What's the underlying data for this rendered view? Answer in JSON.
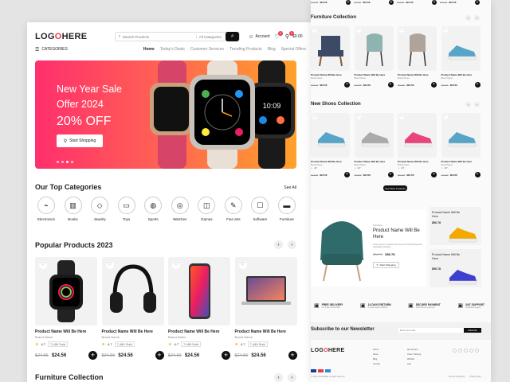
{
  "left": {
    "header": {
      "logo_a": "LOG",
      "logo_b": "O",
      "logo_c": "HERE",
      "search_placeholder": "Search Products",
      "category_select": "All Categories",
      "account": "Account",
      "wishlist_count": "0",
      "cart_count": "0",
      "cart_total": "$0.00"
    },
    "nav": {
      "categories": "CATEGORIES",
      "links": [
        "Home",
        "Today's Deals",
        "Customer Services",
        "Trending Products",
        "Blog",
        "Special Offers"
      ]
    },
    "hero": {
      "line1": "New Year Sale",
      "line2": "Offer 2024",
      "line3": "20% OFF",
      "cta": "Start Shopping",
      "watch_time": "10:09"
    },
    "categories": {
      "title": "Our Top Categories",
      "see_all": "See All",
      "items": [
        {
          "label": "Electronics",
          "icon": "plug-icon",
          "glyph": "⌁"
        },
        {
          "label": "Books",
          "icon": "books-icon",
          "glyph": "▥"
        },
        {
          "label": "Jewelry",
          "icon": "diamond-icon",
          "glyph": "◇"
        },
        {
          "label": "Toys",
          "icon": "car-icon",
          "glyph": "▭"
        },
        {
          "label": "Sports",
          "icon": "ball-icon",
          "glyph": "◍"
        },
        {
          "label": "Watches",
          "icon": "watch-icon",
          "glyph": "◎"
        },
        {
          "label": "Games",
          "icon": "gamepad-icon",
          "glyph": "◫"
        },
        {
          "label": "Fine arts",
          "icon": "brush-icon",
          "glyph": "✎"
        },
        {
          "label": "Software",
          "icon": "cup-icon",
          "glyph": "☐"
        },
        {
          "label": "Furniture",
          "icon": "sofa-icon",
          "glyph": "▬"
        }
      ]
    },
    "popular": {
      "title": "Popular Products 2023",
      "products": [
        {
          "name": "Product Name Will Be Here",
          "brand": "Brand Name",
          "rating": "4.7",
          "sold": "7,489 Sold",
          "old": "$24.56",
          "price": "$24.56",
          "icon": "smartwatch-icon"
        },
        {
          "name": "Product Name Will Be Here",
          "brand": "Brand Name",
          "rating": "4.7",
          "sold": "7,489 Sold",
          "old": "$24.56",
          "price": "$24.56",
          "icon": "headphones-icon"
        },
        {
          "name": "Product Name Will Be Here",
          "brand": "Brand Name",
          "rating": "4.7",
          "sold": "7,489 Sold",
          "old": "$24.56",
          "price": "$24.56",
          "icon": "smartphone-icon"
        },
        {
          "name": "Product Name Will Be Here",
          "brand": "Brand Name",
          "rating": "4.7",
          "sold": "7,489 Sold",
          "old": "$24.56",
          "price": "$24.56",
          "icon": "laptop-icon"
        }
      ]
    },
    "furniture_title": "Furniture Collection"
  },
  "right": {
    "top_prices": [
      {
        "old": "$24.56",
        "price": "$24.56"
      },
      {
        "old": "$24.56",
        "price": "$24.56"
      },
      {
        "old": "$24.56",
        "price": "$24.56"
      },
      {
        "old": "$24.56",
        "price": "$24.56"
      }
    ],
    "furniture": {
      "title": "Furniture Collection",
      "products": [
        {
          "name": "Product Name Will Be Here",
          "brand": "Brand Name",
          "old": "$24.56",
          "price": "$24.56",
          "icon": "armchair-icon",
          "color": "#3d4a66"
        },
        {
          "name": "Product Name Will Be Here",
          "brand": "Brand Name",
          "old": "$24.56",
          "price": "$24.56",
          "icon": "chair-icon",
          "color": "#8fb3b0"
        },
        {
          "name": "Product Name Will Be Here",
          "brand": "Brand Name",
          "old": "$24.56",
          "price": "$24.56",
          "icon": "chair-icon",
          "color": "#b0a39a"
        },
        {
          "name": "Product Name Will Be Here",
          "brand": "Brand Name",
          "old": "$24.56",
          "price": "$24.56",
          "icon": "sneaker-icon",
          "color": "#57a4c9"
        }
      ]
    },
    "shoes": {
      "title": "New Shoes Collection",
      "see_more": "See More Products",
      "products": [
        {
          "name": "Product Name Will Be Here",
          "brand": "Brand Name",
          "rating": "4.7",
          "old": "$24.56",
          "price": "$24.56",
          "color": "#57a4c9"
        },
        {
          "name": "Product Name Will Be Here",
          "brand": "Brand Name",
          "rating": "4.7",
          "old": "$24.56",
          "price": "$24.56",
          "color": "#aaaaaa"
        },
        {
          "name": "Product Name Will Be Here",
          "brand": "Brand Name",
          "rating": "4.7",
          "old": "$24.56",
          "price": "$24.56",
          "color": "#e8457a"
        },
        {
          "name": "Product Name Will Be Here",
          "brand": "Brand Name",
          "rating": "4.7",
          "old": "$24.56",
          "price": "$24.56",
          "color": "#57a4c9"
        }
      ]
    },
    "promo": {
      "tag": "Furniture",
      "title": "Product Name Will Be Here",
      "desc": "Lorem ipsum is simply dummy text of the printing and typesetting industry.",
      "old": "$56.78",
      "price": "$56.78",
      "cta": "Start Shopping",
      "side": [
        {
          "name": "Product Name Will Be Here",
          "price": "$56.78",
          "color": "#f2a900"
        },
        {
          "name": "Product Name Will Be Here",
          "price": "$56.78",
          "color": "#3d3fd0"
        }
      ]
    },
    "features": [
      {
        "title": "FREE DELIVERY",
        "sub": "For orders above $99",
        "icon": "truck-icon"
      },
      {
        "title": "14 DAYS RETURN",
        "sub": "If goods have problems",
        "icon": "return-icon"
      },
      {
        "title": "SECURE PAYMENT",
        "sub": "100% secure payment",
        "icon": "card-icon"
      },
      {
        "title": "24/7 SUPPORT",
        "sub": "Dedicated support",
        "icon": "headset-icon"
      }
    ],
    "newsletter": {
      "title": "Subscribe to our Newsletter",
      "placeholder": "Enter your email",
      "button": "Subscribe"
    },
    "footer": {
      "col1": [
        "Home",
        "About",
        "Blog",
        "Contact"
      ],
      "col2": [
        "My Account",
        "Order Tracking",
        "Wishlist",
        "Cart"
      ],
      "copyright": "© 2024 LOGOHERE. All rights reserved.",
      "terms": "Terms & Conditions",
      "privacy": "Privacy policy"
    }
  },
  "colors": {
    "accent": "#e83b4a",
    "dark": "#111111",
    "hero_from": "#ff2f6d",
    "hero_to": "#ffb020"
  }
}
